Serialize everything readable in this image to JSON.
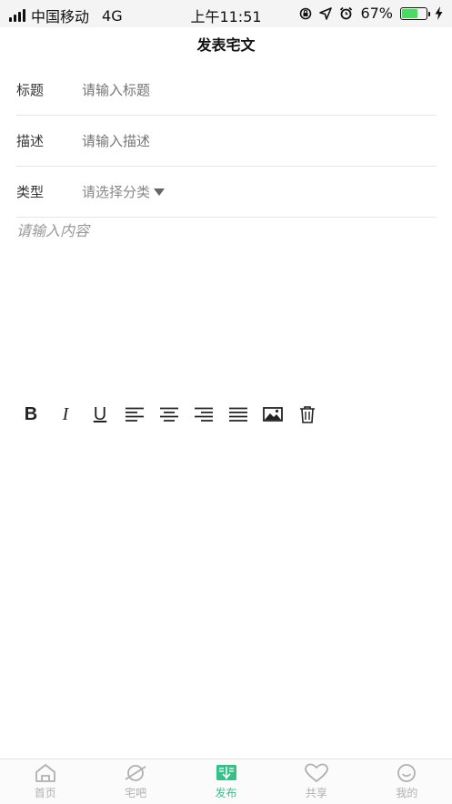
{
  "status_bar": {
    "carrier": "中国移动",
    "network": "4G",
    "time": "上午11:51",
    "battery_percent": "67%",
    "battery_level": 0.67
  },
  "header": {
    "title": "发表宅文"
  },
  "form": {
    "title_label": "标题",
    "title_placeholder": "请输入标题",
    "desc_label": "描述",
    "desc_placeholder": "请输入描述",
    "type_label": "类型",
    "type_select": "请选择分类"
  },
  "editor": {
    "placeholder": "请输入内容"
  },
  "toolbar": {
    "bold": "B",
    "italic": "I",
    "underline": "U",
    "icons": [
      "align-left-icon",
      "align-center-icon",
      "align-right-icon",
      "align-justify-icon",
      "image-icon",
      "trash-icon"
    ]
  },
  "tabbar": {
    "active_color": "#39c08a",
    "items": [
      {
        "label": "首页",
        "icon": "home-icon"
      },
      {
        "label": "宅吧",
        "icon": "planet-icon"
      },
      {
        "label": "发布",
        "icon": "book-icon"
      },
      {
        "label": "共享",
        "icon": "heart-icon"
      },
      {
        "label": "我的",
        "icon": "smile-icon"
      }
    ]
  }
}
